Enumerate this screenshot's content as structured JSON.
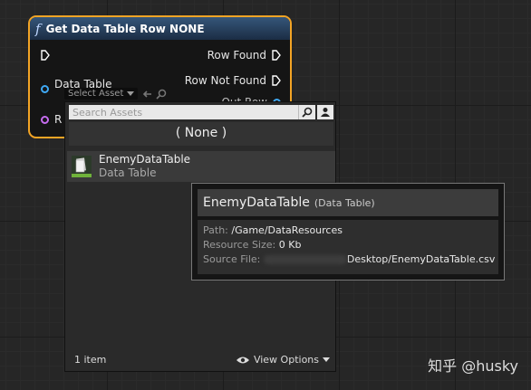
{
  "node": {
    "title": "Get Data Table Row NONE",
    "func_icon": "f",
    "outputs": {
      "row_found": "Row Found",
      "row_not_found": "Row Not Found",
      "partial": "Out Row"
    },
    "inputs": {
      "data_table": "Data Table",
      "select_asset": "Select Asset",
      "partial_label": "R"
    }
  },
  "picker": {
    "search_placeholder": "Search Assets",
    "none_option": "( None )",
    "asset": {
      "name": "EnemyDataTable",
      "type": "Data Table"
    },
    "item_count": "1 item",
    "view_options": "View Options"
  },
  "tooltip": {
    "name": "EnemyDataTable",
    "type": "(Data Table)",
    "path_key": "Path:",
    "path_val": "/Game/DataResources",
    "size_key": "Resource Size:",
    "size_val": "0 Kb",
    "source_key": "Source File:",
    "source_val": "Desktop/EnemyDataTable.csv"
  },
  "watermark": "知乎 @husky",
  "colors": {
    "node_border": "#f3a425",
    "exec_pin": "#ffffff",
    "table_pin": "#3fa9f5",
    "struct_pin": "#c66cf0"
  }
}
